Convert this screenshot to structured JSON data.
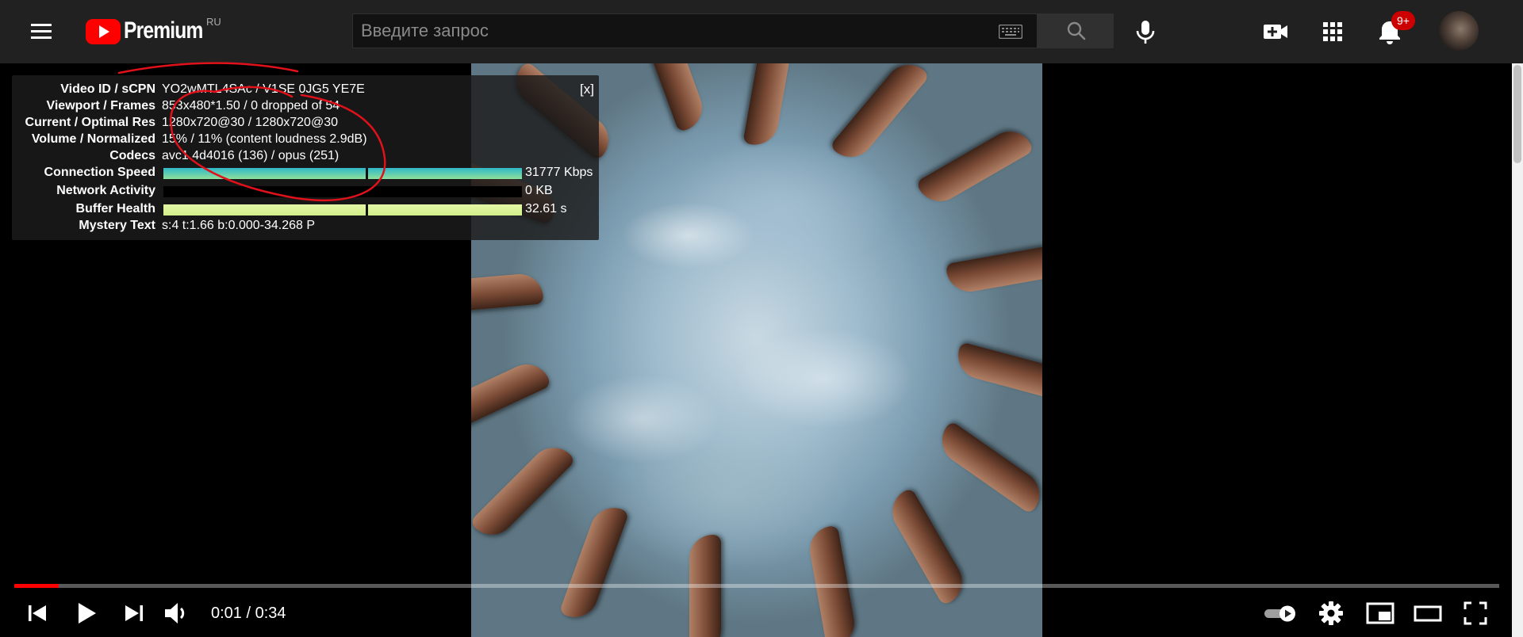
{
  "header": {
    "logo_text": "Premium",
    "logo_region": "RU",
    "search_placeholder": "Введите запрос",
    "notifications_count": "9+"
  },
  "stats": {
    "close_label": "[x]",
    "rows": [
      {
        "label": "Video ID / sCPN",
        "value": "YO2wMTL4SAc / V1SE 0JG5 YE7E"
      },
      {
        "label": "Viewport / Frames",
        "value": "853x480*1.50 / 0 dropped of 54"
      },
      {
        "label": "Current / Optimal Res",
        "value": "1280x720@30 / 1280x720@30"
      },
      {
        "label": "Volume / Normalized",
        "value": "15% / 11% (content loudness 2.9dB)"
      },
      {
        "label": "Codecs",
        "value": "avc1.4d4016 (136) / opus (251)"
      }
    ],
    "bars": [
      {
        "label": "Connection Speed",
        "value": "31777 Kbps",
        "fill": 1.0,
        "color_top": "#2fb8c9",
        "color_bottom": "#8fe09a"
      },
      {
        "label": "Network Activity",
        "value": "0 KB",
        "fill": 0.0,
        "color_top": "#000000",
        "color_bottom": "#000000"
      },
      {
        "label": "Buffer Health",
        "value": "32.61 s",
        "fill": 1.0,
        "color_top": "#e4f7a6",
        "color_bottom": "#d2ef8a"
      }
    ],
    "mystery": {
      "label": "Mystery Text",
      "value": "s:4 t:1.66 b:0.000-34.268 P"
    }
  },
  "player": {
    "time_current": "0:01",
    "time_total": "0:34",
    "progress": 0.03,
    "autoplay_on": true
  },
  "colors": {
    "header_bg": "#212121",
    "accent_red": "#ff0000",
    "badge_red": "#cc0000",
    "annotation_red": "#e0111b"
  }
}
